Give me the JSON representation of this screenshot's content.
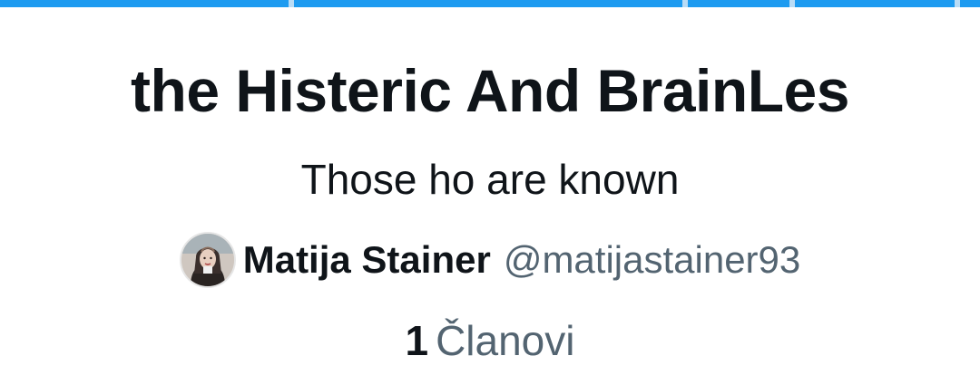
{
  "list": {
    "title": "the Histeric And BrainLes",
    "description": "Those ho are known",
    "owner": {
      "display_name": "Matija Stainer",
      "handle": "@matijastainer93",
      "avatar_icon": "user-avatar-photo"
    },
    "members": {
      "count": "1",
      "label": "Članovi"
    }
  },
  "colors": {
    "banner": "#1d9bf0",
    "primary_text": "#0f1419",
    "secondary_text": "#536471"
  }
}
